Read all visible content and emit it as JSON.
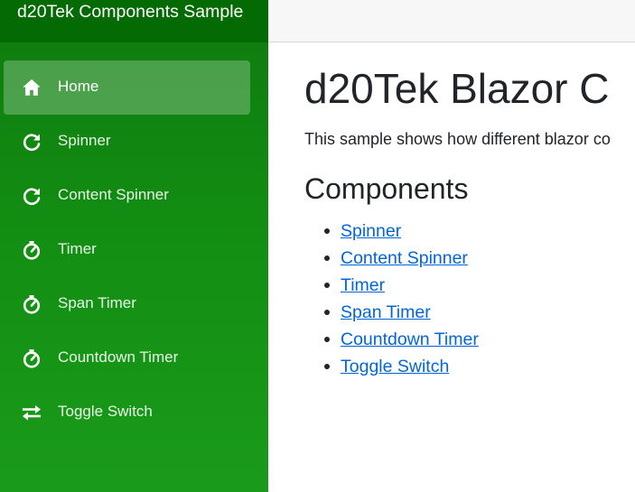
{
  "sidebar": {
    "brand": "d20Tek Components Sample",
    "items": [
      {
        "label": "Home",
        "icon": "home-icon",
        "active": true
      },
      {
        "label": "Spinner",
        "icon": "refresh-icon",
        "active": false
      },
      {
        "label": "Content Spinner",
        "icon": "refresh-icon",
        "active": false
      },
      {
        "label": "Timer",
        "icon": "timer-icon",
        "active": false
      },
      {
        "label": "Span Timer",
        "icon": "timer-icon",
        "active": false
      },
      {
        "label": "Countdown Timer",
        "icon": "timer-icon",
        "active": false
      },
      {
        "label": "Toggle Switch",
        "icon": "swap-arrows-icon",
        "active": false
      }
    ]
  },
  "main": {
    "title": "d20Tek Blazor C",
    "intro": "This sample shows how different blazor co",
    "section_title": "Components",
    "links": [
      {
        "label": "Spinner"
      },
      {
        "label": "Content Spinner"
      },
      {
        "label": "Timer"
      },
      {
        "label": "Span Timer"
      },
      {
        "label": "Countdown Timer"
      },
      {
        "label": "Toggle Switch"
      }
    ]
  },
  "colors": {
    "sidebar_top": "#046a04",
    "sidebar_green": "#138f13",
    "link": "#0366d6",
    "text": "#212529"
  }
}
